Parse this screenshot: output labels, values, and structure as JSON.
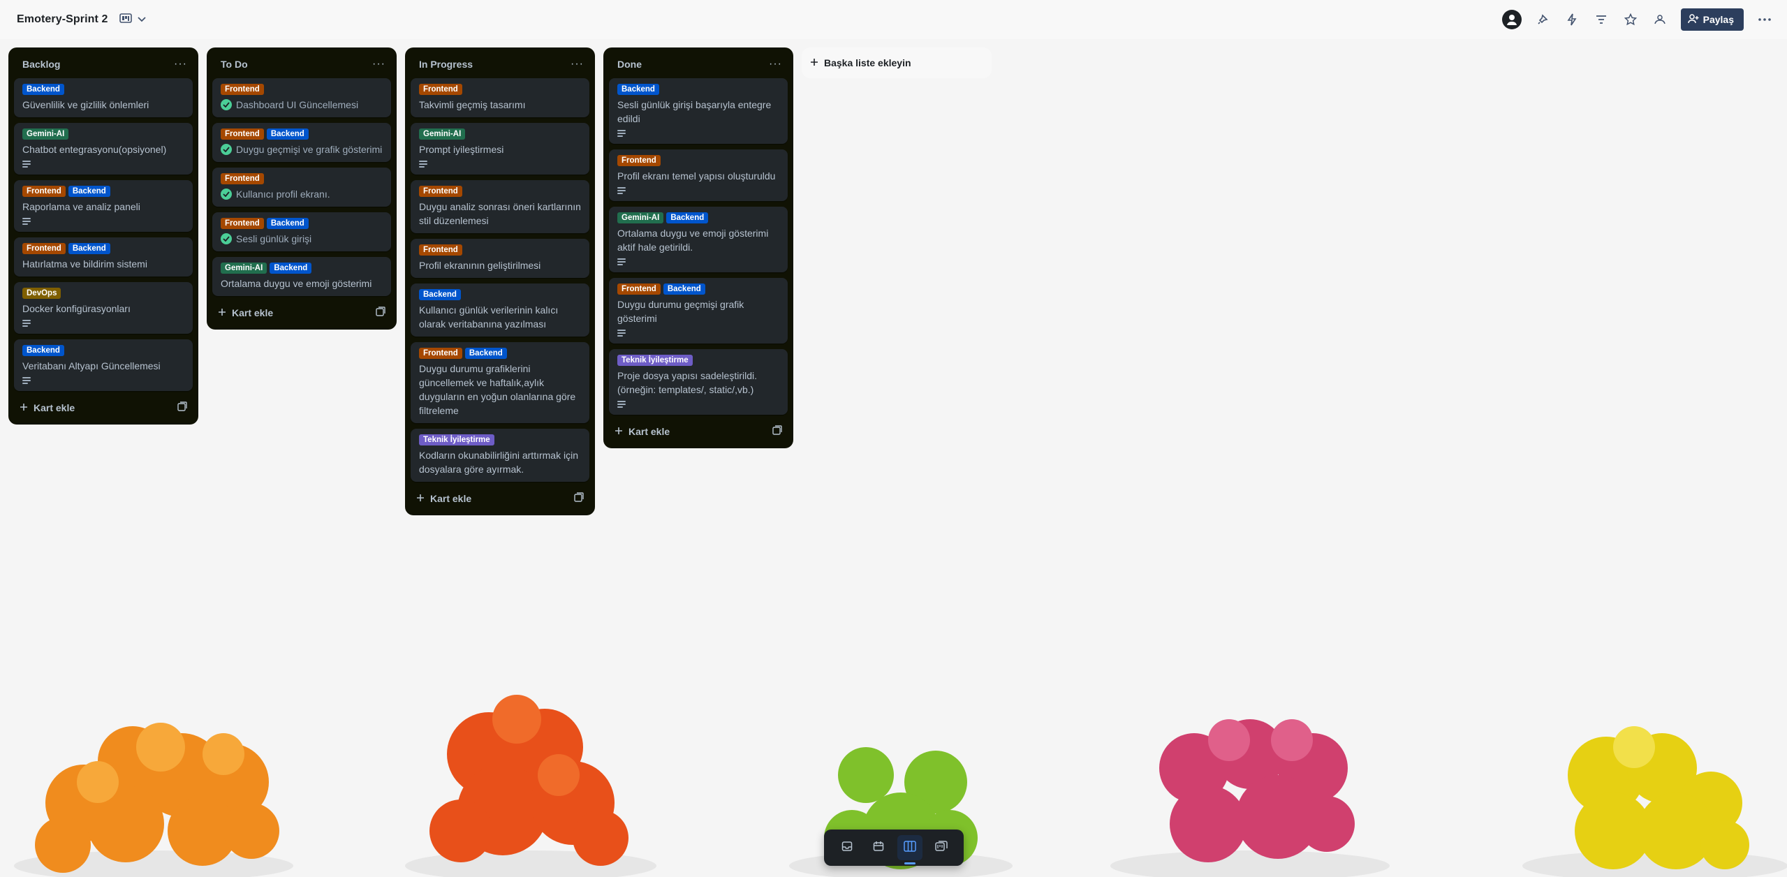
{
  "header": {
    "board_title": "Emotery-Sprint 2",
    "share_label": "Paylaş"
  },
  "colors": {
    "Frontend": "#a54800",
    "Backend": "#0055cc",
    "Gemini-AI": "#216e4e",
    "DevOps": "#7f5f01",
    "Teknik İyileştirme": "#6e5dc6"
  },
  "lists": [
    {
      "title": "Backlog",
      "add_card": "Kart ekle",
      "cards": [
        {
          "labels": [
            "Backend"
          ],
          "title": "Güvenlilik ve gizlilik önlemleri",
          "done": false,
          "desc": false
        },
        {
          "labels": [
            "Gemini-AI"
          ],
          "title": "Chatbot entegrasyonu(opsiyonel)",
          "done": false,
          "desc": true
        },
        {
          "labels": [
            "Frontend",
            "Backend"
          ],
          "title": "Raporlama ve analiz paneli",
          "done": false,
          "desc": true
        },
        {
          "labels": [
            "Frontend",
            "Backend"
          ],
          "title": "Hatırlatma ve bildirim sistemi",
          "done": false,
          "desc": false
        },
        {
          "labels": [
            "DevOps"
          ],
          "title": "Docker konfigürasyonları",
          "done": false,
          "desc": true
        },
        {
          "labels": [
            "Backend"
          ],
          "title": "Veritabanı Altyapı Güncellemesi",
          "done": false,
          "desc": true
        }
      ]
    },
    {
      "title": "To Do",
      "add_card": "Kart ekle",
      "cards": [
        {
          "labels": [
            "Frontend"
          ],
          "title": "Dashboard UI Güncellemesi",
          "done": true,
          "desc": false
        },
        {
          "labels": [
            "Frontend",
            "Backend"
          ],
          "title": "Duygu geçmişi ve grafik gösterimi",
          "done": true,
          "desc": false
        },
        {
          "labels": [
            "Frontend"
          ],
          "title": "Kullanıcı profil ekranı.",
          "done": true,
          "desc": false
        },
        {
          "labels": [
            "Frontend",
            "Backend"
          ],
          "title": "Sesli günlük girişi",
          "done": true,
          "desc": false
        },
        {
          "labels": [
            "Gemini-AI",
            "Backend"
          ],
          "title": "Ortalama duygu ve emoji gösterimi",
          "done": false,
          "desc": false
        }
      ]
    },
    {
      "title": "In Progress",
      "add_card": "Kart ekle",
      "cards": [
        {
          "labels": [
            "Frontend"
          ],
          "title": "Takvimli geçmiş tasarımı",
          "done": false,
          "desc": false
        },
        {
          "labels": [
            "Gemini-AI"
          ],
          "title": "Prompt iyileştirmesi",
          "done": false,
          "desc": true
        },
        {
          "labels": [
            "Frontend"
          ],
          "title": "Duygu analiz sonrası öneri kartlarının stil düzenlemesi",
          "done": false,
          "desc": false
        },
        {
          "labels": [
            "Frontend"
          ],
          "title": "Profil ekranının geliştirilmesi",
          "done": false,
          "desc": false
        },
        {
          "labels": [
            "Backend"
          ],
          "title": "Kullanıcı günlük verilerinin kalıcı olarak veritabanına yazılması",
          "done": false,
          "desc": false
        },
        {
          "labels": [
            "Frontend",
            "Backend"
          ],
          "title": "Duygu durumu grafiklerini güncellemek ve haftalık,aylık duyguların en yoğun olanlarına göre filtreleme",
          "done": false,
          "desc": false
        },
        {
          "labels": [
            "Teknik İyileştirme"
          ],
          "title": "Kodların okunabilirliğini arttırmak için dosyalara göre ayırmak.",
          "done": false,
          "desc": false
        }
      ]
    },
    {
      "title": "Done",
      "add_card": "Kart ekle",
      "cards": [
        {
          "labels": [
            "Backend"
          ],
          "title": "Sesli günlük girişi başarıyla entegre edildi",
          "done": false,
          "desc": true
        },
        {
          "labels": [
            "Frontend"
          ],
          "title": "Profil ekranı temel yapısı oluşturuldu",
          "done": false,
          "desc": true
        },
        {
          "labels": [
            "Gemini-AI",
            "Backend"
          ],
          "title": "Ortalama duygu ve emoji gösterimi aktif hale getirildi.",
          "done": false,
          "desc": true
        },
        {
          "labels": [
            "Frontend",
            "Backend"
          ],
          "title": "Duygu durumu geçmişi grafik gösterimi",
          "done": false,
          "desc": true
        },
        {
          "labels": [
            "Teknik İyileştirme"
          ],
          "title": "Proje dosya yapısı sadeleştirildi. (örneğin: templates/, static/,vb.)",
          "done": false,
          "desc": true
        }
      ]
    }
  ],
  "add_list_label": "Başka liste ekleyin",
  "switcher": {
    "items": [
      "inbox-icon",
      "calendar-icon",
      "board-icon",
      "switch-boards-icon"
    ],
    "active": "board-icon"
  }
}
